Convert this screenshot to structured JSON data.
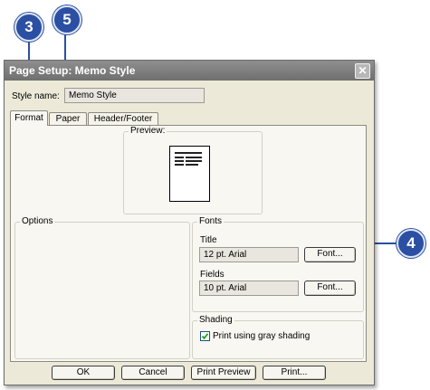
{
  "callouts": [
    "3",
    "5",
    "4"
  ],
  "dialog": {
    "title": "Page Setup: Memo Style",
    "close_glyph": "✕",
    "style_name_label": "Style name:",
    "style_name_value": "Memo Style",
    "tabs": [
      "Format",
      "Paper",
      "Header/Footer"
    ],
    "preview_label": "Preview:",
    "options_label": "Options",
    "fonts": {
      "group_label": "Fonts",
      "title_label": "Title",
      "title_value": "12 pt. Arial",
      "fields_label": "Fields",
      "fields_value": "10 pt. Arial",
      "font_button": "Font..."
    },
    "shading": {
      "group_label": "Shading",
      "checkbox_label": "Print using gray shading",
      "checked": true
    },
    "buttons": [
      "OK",
      "Cancel",
      "Print Preview",
      "Print..."
    ]
  },
  "colors": {
    "callout": "#2b4fa2",
    "dialog_face": "#ece9d8"
  }
}
